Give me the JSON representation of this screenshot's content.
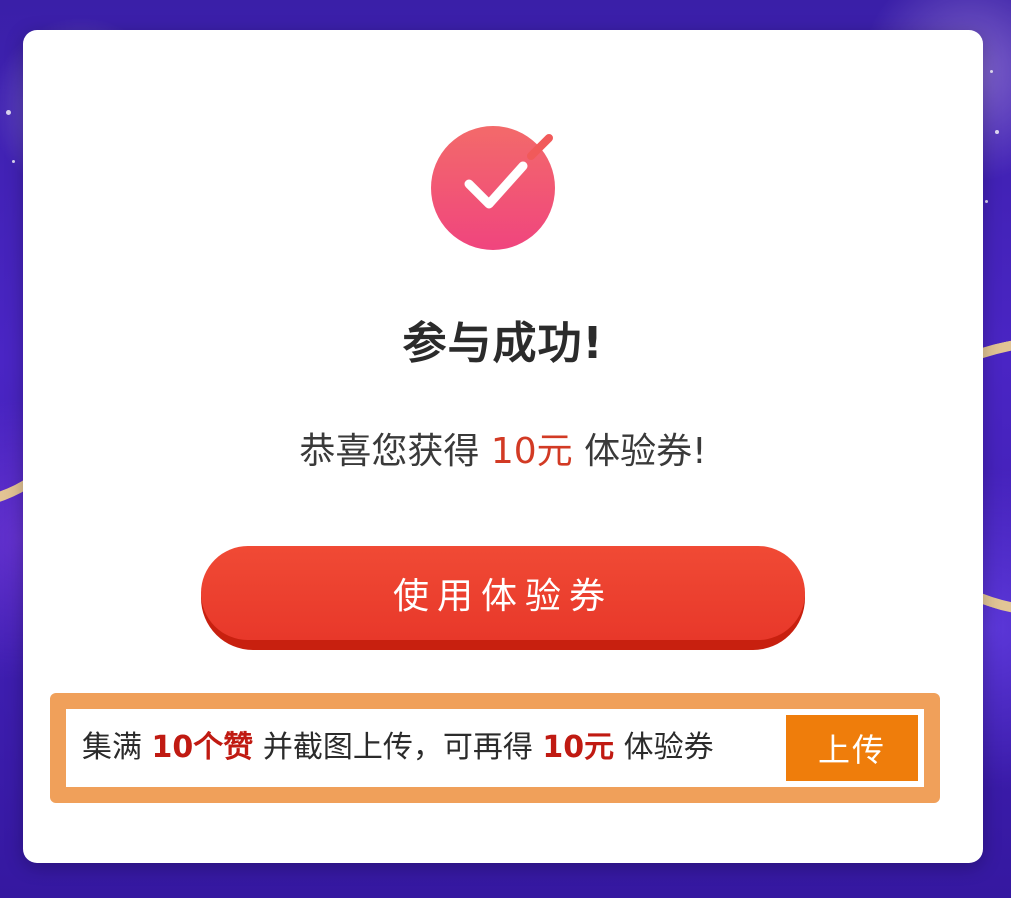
{
  "dialog": {
    "title": "参与成功!",
    "congrats": {
      "prefix": "恭喜您获得 ",
      "amount": "10元",
      "suffix": " 体验券!"
    },
    "use_button_label": "使用体验券",
    "upload": {
      "text_1": "集满 ",
      "highlight_1": "10个赞",
      "text_2": " 并截图上传，可再得 ",
      "highlight_2": "10元",
      "text_3": " 体验券",
      "button_label": "上传"
    }
  },
  "icons": {
    "success": "checkmark-circle-icon"
  },
  "colors": {
    "primary_red": "#e8382a",
    "highlight_red": "#c01a12",
    "amount_red": "#d23a24",
    "upload_orange": "#ef7d0b",
    "banner_border": "#f0a05a",
    "background_purple": "#3a1fa8"
  }
}
